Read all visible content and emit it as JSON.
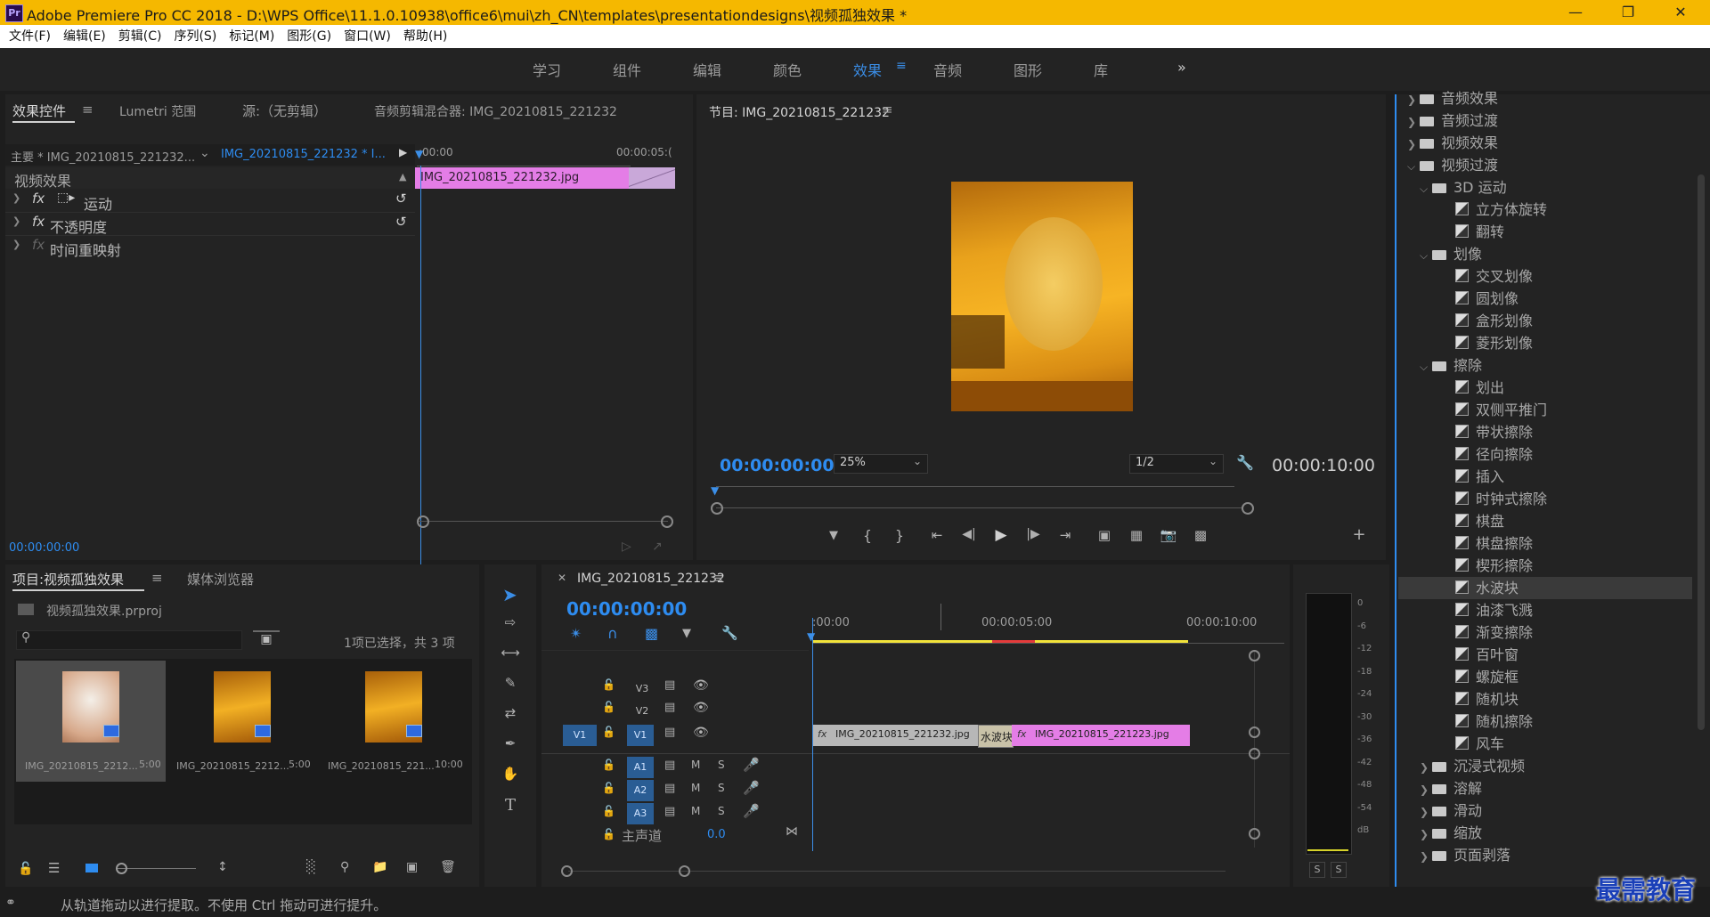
{
  "titlebar": {
    "title": "Adobe Premiere Pro CC 2018 - D:\\WPS Office\\11.1.0.10938\\office6\\mui\\zh_CN\\templates\\presentationdesigns\\视频孤独效果 *",
    "app_icon": "Pr"
  },
  "menu": [
    "文件(F)",
    "编辑(E)",
    "剪辑(C)",
    "序列(S)",
    "标记(M)",
    "图形(G)",
    "窗口(W)",
    "帮助(H)"
  ],
  "workspaces": [
    "学习",
    "组件",
    "编辑",
    "颜色",
    "效果",
    "音频",
    "图形",
    "库"
  ],
  "workspace_active": "效果",
  "effect_controls": {
    "tabs": [
      "效果控件",
      "Lumetri 范围",
      "源:（无剪辑）",
      "音频剪辑混合器: IMG_20210815_221232"
    ],
    "master_label": "主要 * IMG_20210815_221232...",
    "clip_label": "IMG_20210815_221232 * I...",
    "time_start": ":00:00",
    "time_end": "00:00:05:(",
    "clip_name": "IMG_20210815_221232.jpg",
    "section": "视频效果",
    "effects": [
      "运动",
      "不透明度",
      "时间重映射"
    ],
    "timecode": "00:00:00:00"
  },
  "program": {
    "title": "节目: IMG_20210815_221232",
    "timecode": "00:00:00:00",
    "zoom": "25%",
    "resolution": "1/2",
    "duration": "00:00:10:00"
  },
  "project": {
    "tabs": [
      "项目:视频孤独效果",
      "媒体浏览器"
    ],
    "file": "视频孤独效果.prproj",
    "selection": "1项已选择，共 3 项",
    "items": [
      {
        "name": "IMG_20210815_2212...",
        "duration": "5:00"
      },
      {
        "name": "IMG_20210815_2212...",
        "duration": "5:00"
      },
      {
        "name": "IMG_20210815_221...",
        "duration": "10:00"
      }
    ]
  },
  "timeline": {
    "tab": "IMG_20210815_221232",
    "timecode": "00:00:00:00",
    "ruler": [
      ":00:00",
      "00:00:05:00",
      "00:00:10:00"
    ],
    "tracks_video": [
      "V3",
      "V2",
      "V1"
    ],
    "tracks_audio": [
      "A1",
      "A2",
      "A3"
    ],
    "source_patch": "V1",
    "master": "主声道",
    "master_value": "0.0",
    "clips": [
      "IMG_20210815_221232.jpg",
      "IMG_20210815_221223.jpg"
    ],
    "transition": "水波块"
  },
  "meter": {
    "scale": [
      "0",
      "-6",
      "-12",
      "-18",
      "-24",
      "-30",
      "-36",
      "-42",
      "-48",
      "-54",
      "dB"
    ],
    "solo": [
      "S",
      "S"
    ]
  },
  "effects_tree": [
    {
      "level": 0,
      "type": "folder",
      "open": false,
      "label": "音频效果"
    },
    {
      "level": 0,
      "type": "folder",
      "open": false,
      "label": "音频过渡"
    },
    {
      "level": 0,
      "type": "folder",
      "open": false,
      "label": "视频效果"
    },
    {
      "level": 0,
      "type": "folder",
      "open": true,
      "label": "视频过渡"
    },
    {
      "level": 1,
      "type": "folder",
      "open": true,
      "label": "3D 运动"
    },
    {
      "level": 2,
      "type": "item",
      "label": "立方体旋转"
    },
    {
      "level": 2,
      "type": "item",
      "label": "翻转"
    },
    {
      "level": 1,
      "type": "folder",
      "open": true,
      "label": "划像"
    },
    {
      "level": 2,
      "type": "item",
      "label": "交叉划像"
    },
    {
      "level": 2,
      "type": "item",
      "label": "圆划像"
    },
    {
      "level": 2,
      "type": "item",
      "label": "盒形划像"
    },
    {
      "level": 2,
      "type": "item",
      "label": "菱形划像"
    },
    {
      "level": 1,
      "type": "folder",
      "open": true,
      "label": "擦除"
    },
    {
      "level": 2,
      "type": "item",
      "label": "划出"
    },
    {
      "level": 2,
      "type": "item",
      "label": "双侧平推门"
    },
    {
      "level": 2,
      "type": "item",
      "label": "带状擦除"
    },
    {
      "level": 2,
      "type": "item",
      "label": "径向擦除"
    },
    {
      "level": 2,
      "type": "item",
      "label": "插入"
    },
    {
      "level": 2,
      "type": "item",
      "label": "时钟式擦除"
    },
    {
      "level": 2,
      "type": "item",
      "label": "棋盘"
    },
    {
      "level": 2,
      "type": "item",
      "label": "棋盘擦除"
    },
    {
      "level": 2,
      "type": "item",
      "label": "楔形擦除"
    },
    {
      "level": 2,
      "type": "item",
      "label": "水波块",
      "selected": true
    },
    {
      "level": 2,
      "type": "item",
      "label": "油漆飞溅"
    },
    {
      "level": 2,
      "type": "item",
      "label": "渐变擦除"
    },
    {
      "level": 2,
      "type": "item",
      "label": "百叶窗"
    },
    {
      "level": 2,
      "type": "item",
      "label": "螺旋框"
    },
    {
      "level": 2,
      "type": "item",
      "label": "随机块"
    },
    {
      "level": 2,
      "type": "item",
      "label": "随机擦除"
    },
    {
      "level": 2,
      "type": "item",
      "label": "风车"
    },
    {
      "level": 1,
      "type": "folder",
      "open": false,
      "label": "沉浸式视频"
    },
    {
      "level": 1,
      "type": "folder",
      "open": false,
      "label": "溶解"
    },
    {
      "level": 1,
      "type": "folder",
      "open": false,
      "label": "滑动"
    },
    {
      "level": 1,
      "type": "folder",
      "open": false,
      "label": "缩放"
    },
    {
      "level": 1,
      "type": "folder",
      "open": false,
      "label": "页面剥落"
    }
  ],
  "status": "从轨道拖动以进行提取。不使用 Ctrl 拖动可进行提升。",
  "watermark": "最需教育",
  "colors": {
    "accent": "#2e8cf0",
    "titlebar": "#f5b800",
    "clip_pink": "#e47de6",
    "clip_grey": "#b7b7b7",
    "ws_line": "#f2e33a"
  }
}
